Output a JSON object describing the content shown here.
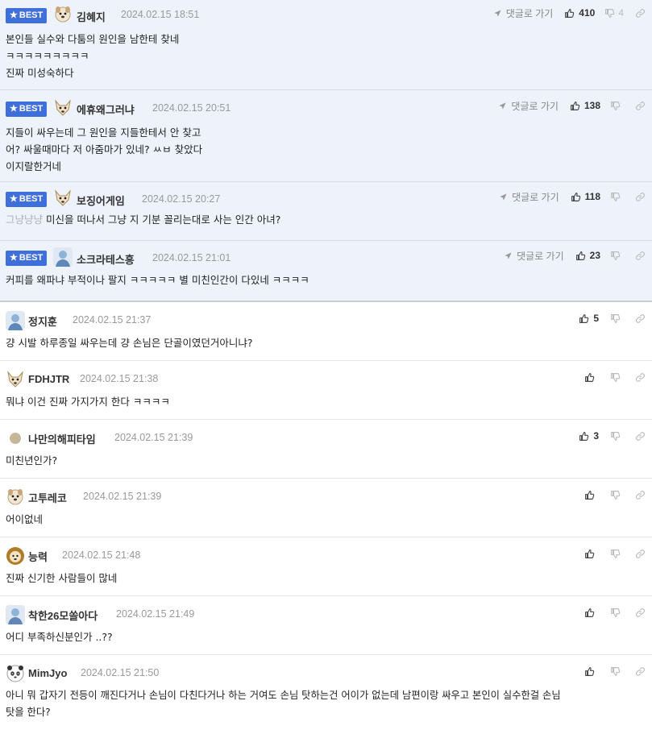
{
  "best_label": "BEST",
  "goto_label": "댓글로 가기",
  "comments": [
    {
      "nick": "김혜지",
      "time": "2024.02.15 18:51",
      "likes": "410",
      "dislikes": "4",
      "lines": [
        "본인들 실수와 다툼의 원인을 남한테 찾네",
        "ㅋㅋㅋㅋㅋㅋㅋㅋㅋ",
        "진짜 미성숙하다"
      ]
    },
    {
      "nick": "에휴왜그러냐",
      "time": "2024.02.15 20:51",
      "likes": "138",
      "dislikes": "",
      "lines": [
        "지들이 싸우는데 그 원인을 지들한테서 안 찾고",
        "어? 싸울때마다 저 아줌마가 있네? ㅆㅂ 찾았다",
        "이지랄한거네"
      ]
    },
    {
      "nick": "보징어게임",
      "time": "2024.02.15 20:27",
      "likes": "118",
      "dislikes": "",
      "dim_prefix": "그냥냥냥",
      "lines": [
        " 미신을 떠나서 그냥 지 기분 꼴리는대로 사는 인간 아녀?"
      ]
    },
    {
      "nick": "소크라테스흥",
      "time": "2024.02.15 21:01",
      "likes": "23",
      "dislikes": "",
      "lines": [
        "커피를 왜파냐 부적이나 팔지 ㅋㅋㅋㅋㅋ 별 미친인간이 다있네 ㅋㅋㅋㅋ"
      ]
    },
    {
      "nick": "정지훈",
      "time": "2024.02.15 21:37",
      "likes": "5",
      "lines": [
        "걍 시발 하루종일 싸우는데 걍 손님은 단골이였던거아니냐?"
      ]
    },
    {
      "nick": "FDHJTR",
      "time": "2024.02.15 21:38",
      "likes": "",
      "lines": [
        "뭐냐 이건 진짜 가지가지 한다 ㅋㅋㅋㅋ"
      ]
    },
    {
      "nick": "나만의해피타임",
      "time": "2024.02.15 21:39",
      "likes": "3",
      "lines": [
        "미친년인가?"
      ]
    },
    {
      "nick": "고투레코",
      "time": "2024.02.15 21:39",
      "likes": "",
      "lines": [
        "어이없네"
      ]
    },
    {
      "nick": "능력",
      "time": "2024.02.15 21:48",
      "likes": "",
      "lines": [
        "진짜 신기한 사람들이 많네"
      ]
    },
    {
      "nick": "착한26모쏠아다",
      "time": "2024.02.15 21:49",
      "likes": "",
      "lines": [
        "어디 부족하신분인가 ..??"
      ]
    },
    {
      "nick": "MimJyo",
      "time": "2024.02.15 21:50",
      "likes": "",
      "lines": [
        "아니 뭐 갑자기 전등이 깨진다거나 손님이 다친다거나 하는 거여도 손님 탓하는건 어이가 없는데 남편이랑 싸우고 본인이 실수한걸 손님",
        "탓을 한다?"
      ]
    }
  ],
  "colors": {
    "best_badge": "#3f6fd8",
    "best_bg": "#eef3fb"
  },
  "icons": {
    "like": "thumbs-up-icon",
    "dislike": "thumbs-down-icon",
    "goto": "arrow-pointer-icon",
    "link": "link-icon"
  }
}
